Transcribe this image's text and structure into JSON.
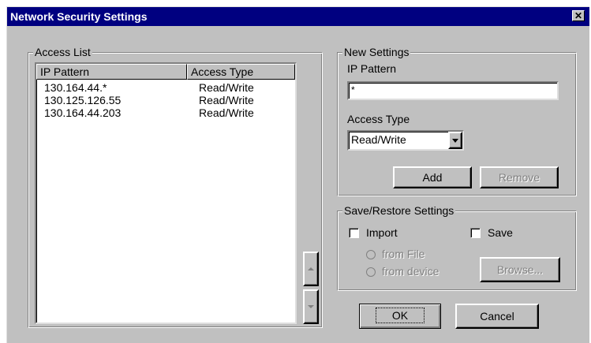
{
  "window": {
    "title": "Network Security Settings",
    "close_glyph": "✕"
  },
  "access_list": {
    "legend": "Access List",
    "columns": [
      "IP Pattern",
      "Access Type"
    ],
    "rows": [
      {
        "ip": "130.164.44.*",
        "type": "Read/Write"
      },
      {
        "ip": "130.125.126.55",
        "type": "Read/Write"
      },
      {
        "ip": "130.164.44.203",
        "type": "Read/Write"
      }
    ]
  },
  "new_settings": {
    "legend": "New Settings",
    "ip_label": "IP Pattern",
    "ip_value": "*",
    "access_label": "Access Type",
    "access_value": "Read/Write",
    "add_label": "Add",
    "remove_label": "Remove"
  },
  "save_restore": {
    "legend": "Save/Restore Settings",
    "import_label": "Import",
    "save_label": "Save",
    "from_file_label": "from File",
    "from_device_label": "from device",
    "browse_label": "Browse..."
  },
  "footer": {
    "ok_label": "OK",
    "cancel_label": "Cancel"
  },
  "icons": {
    "close": "close-icon",
    "scroll_up": "scroll-up-icon",
    "scroll_down": "scroll-down-icon",
    "dropdown": "chevron-down-icon"
  },
  "colors": {
    "titlebar": "#000080",
    "face": "#c0c0c0"
  }
}
